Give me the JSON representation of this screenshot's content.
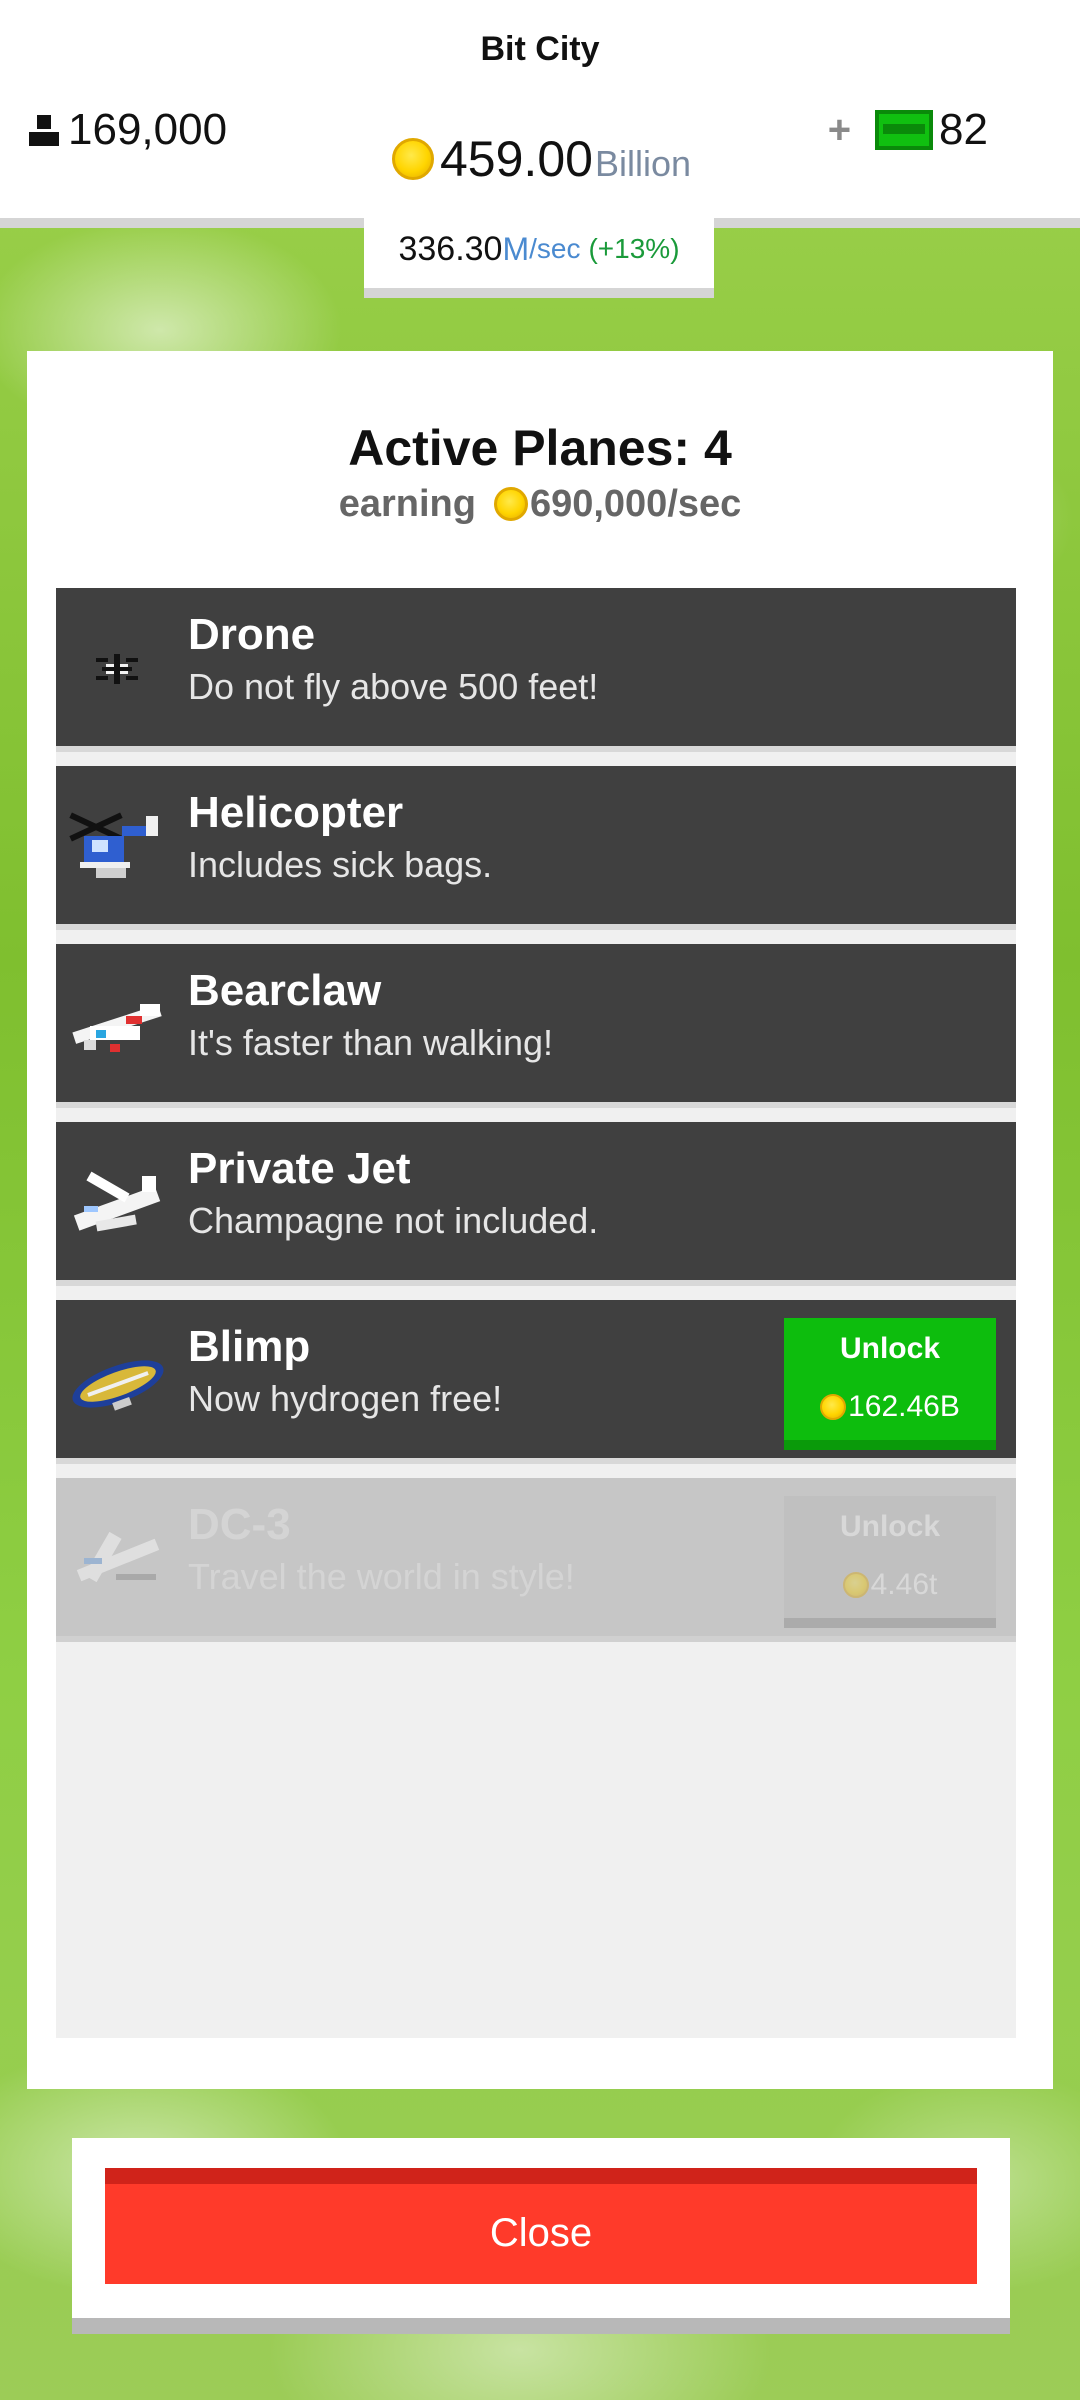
{
  "header": {
    "city_title": "Bit City",
    "population": "169,000",
    "coins_value": "459.00",
    "coins_unit": "Billion",
    "gems_plus": "+",
    "gems_value": "82",
    "rate_value": "336.30",
    "rate_unit": "M",
    "rate_per": "/sec",
    "rate_bonus": "(+13%)"
  },
  "panel": {
    "title": "Active Planes: 4",
    "earning_label": "earning",
    "earning_value": "690,000/sec"
  },
  "planes": [
    {
      "name": "Drone",
      "desc": "Do not fly above 500 feet!",
      "icon": "drone-icon"
    },
    {
      "name": "Helicopter",
      "desc": "Includes sick bags.",
      "icon": "helicopter-icon"
    },
    {
      "name": "Bearclaw",
      "desc": "It's faster than walking!",
      "icon": "bearclaw-plane-icon"
    },
    {
      "name": "Private Jet",
      "desc": "Champagne not included.",
      "icon": "private-jet-icon"
    },
    {
      "name": "Blimp",
      "desc": "Now hydrogen free!",
      "icon": "blimp-icon",
      "unlock_label": "Unlock",
      "price": "162.46B"
    },
    {
      "name": "DC-3",
      "desc": "Travel the world in style!",
      "icon": "dc3-plane-icon",
      "unlock_label": "Unlock",
      "price": "4.46t"
    }
  ],
  "close_label": "Close"
}
